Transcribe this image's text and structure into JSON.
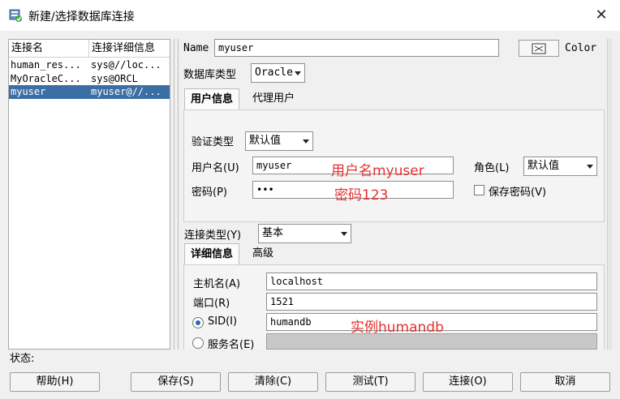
{
  "window": {
    "title": "新建/选择数据库连接",
    "close_glyph": "✕"
  },
  "connections": {
    "columns": [
      "连接名",
      "连接详细信息"
    ],
    "rows": [
      {
        "name": "human_res...",
        "detail": "sys@//loc...",
        "selected": false
      },
      {
        "name": "MyOracleC...",
        "detail": "sys@ORCL",
        "selected": false
      },
      {
        "name": "myuser",
        "detail": "myuser@//...",
        "selected": true
      }
    ]
  },
  "form": {
    "name_label": "Name",
    "name_value": "myuser",
    "color_label": "Color",
    "dbtype_label": "数据库类型",
    "dbtype_value": "Oracle",
    "tabs": [
      "用户信息",
      "代理用户"
    ],
    "auth_label": "验证类型",
    "auth_value": "默认值",
    "username_label": "用户名(U)",
    "username_value": "myuser",
    "role_label": "角色(L)",
    "role_value": "默认值",
    "password_label": "密码(P)",
    "password_value": "•••",
    "save_password_label": "保存密码(V)",
    "save_password_checked": false,
    "conn_type_label": "连接类型(Y)",
    "conn_type_value": "基本",
    "detail_tabs": [
      "详细信息",
      "高级"
    ],
    "host_label": "主机名(A)",
    "host_value": "localhost",
    "port_label": "端口(R)",
    "port_value": "1521",
    "sid_label": "SID(I)",
    "sid_value": "humandb",
    "service_label": "服务名(E)",
    "service_value": ""
  },
  "annotations": {
    "username_note": "用户名myuser",
    "password_note": "密码123",
    "sid_note": "实例humandb",
    "color": "#e53030"
  },
  "status": {
    "label": "状态:"
  },
  "buttons": {
    "help": "帮助(H)",
    "save": "保存(S)",
    "clear": "清除(C)",
    "test": "测试(T)",
    "connect": "连接(O)",
    "cancel": "取消"
  },
  "colors": {
    "selection": "#3a6ea5",
    "background": "#f0f0f0"
  }
}
